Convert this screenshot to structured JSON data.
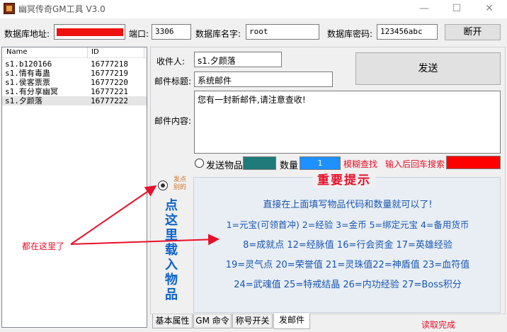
{
  "window": {
    "title": "幽冥传奇GM工具 V3.0",
    "controls": [
      "—",
      "☐",
      "✕"
    ]
  },
  "connection": {
    "db_address_label": "数据库地址:",
    "db_address_value": "",
    "port_label": "端口:",
    "port_value": "3306",
    "db_name_label": "数据库名字:",
    "db_name_value": "root",
    "db_password_label": "数据库密码:",
    "db_password_value": "123456abc",
    "disconnect_label": "断开"
  },
  "list": {
    "columns": [
      "Name",
      "ID"
    ],
    "rows": [
      {
        "name": "s1.b120166",
        "id": "16777218"
      },
      {
        "name": "s1.情有毒蛊",
        "id": "16777219"
      },
      {
        "name": "s1.侯客票票",
        "id": "16777220"
      },
      {
        "name": "s1.有分享幽冥",
        "id": "16777221"
      },
      {
        "name": "s1.夕颜落",
        "id": "16777222"
      }
    ]
  },
  "mail": {
    "recipient_label": "收件人:",
    "recipient_value": "s1.夕颜落",
    "subject_label": "邮件标题:",
    "subject_value": "系统邮件",
    "content_label": "邮件内容:",
    "content_value": "您有一封新邮件,请注意查收!",
    "send_label": "发送",
    "send_item_label": "发送物品",
    "quantity_label": "数量",
    "quantity_value": "1",
    "fuzzy_search_label": "模糊查找",
    "search_hint_label": "输入后回车搜索",
    "item_code_color": "#1e7b7a",
    "search_box_color": "#ff0000"
  },
  "info": {
    "title": "重要提示",
    "lines": [
      "直接在上面填写物品代码和数量就可以了!",
      "1=元宝(可领首冲) 2=经验 3=金币 5=绑定元宝 4=备用货币",
      "8=成就点 12=经脉值 16=行会资金 17=英雄经验",
      "19=灵气点 20=荣誉值 21=灵珠值22=神盾值 23=血符值",
      "24=武魂值 25=特戒结晶 26=内功经验 27=Boss积分"
    ]
  },
  "annotations": {
    "small_hint": "发点别的",
    "big_hint": [
      "点",
      "这",
      "里",
      "载",
      "入",
      "物",
      "品"
    ],
    "arrow_note": "都在这里了"
  },
  "tabs": [
    "基本属性",
    "GM 命令",
    "称号开关",
    "发邮件"
  ],
  "status": "读取完成"
}
